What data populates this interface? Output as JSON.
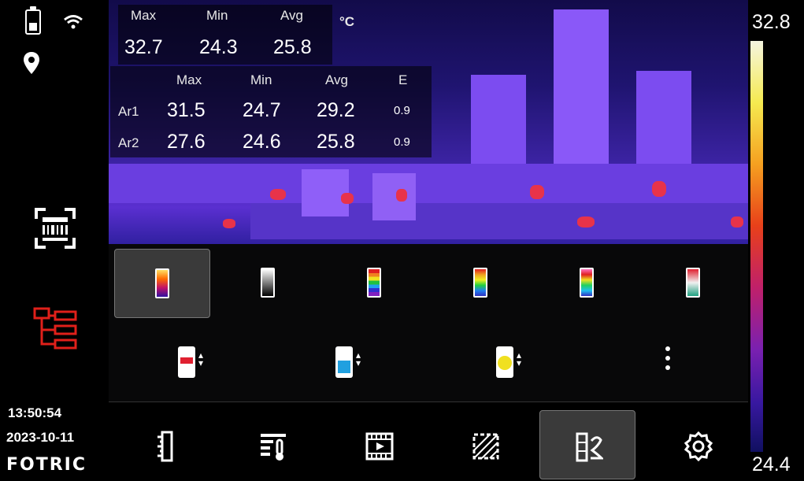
{
  "status": {
    "time": "13:50:54",
    "date": "2023-10-11",
    "brand": "FOTRIC"
  },
  "global_stats": {
    "headers": {
      "max": "Max",
      "min": "Min",
      "avg": "Avg",
      "unit": "°C"
    },
    "max": "32.7",
    "min": "24.3",
    "avg": "25.8"
  },
  "area_stats": {
    "headers": {
      "max": "Max",
      "min": "Min",
      "avg": "Avg",
      "e": "E"
    },
    "rows": [
      {
        "name": "Ar1",
        "max": "31.5",
        "min": "24.7",
        "avg": "29.2",
        "e": "0.9"
      },
      {
        "name": "Ar2",
        "max": "27.6",
        "min": "24.6",
        "avg": "25.8",
        "e": "0.9"
      }
    ]
  },
  "scale": {
    "max": "32.8",
    "min": "24.4"
  },
  "palettes": {
    "selected_index": 0,
    "items": [
      "iron-palette-icon",
      "grayscale-palette-icon",
      "rainbow-palette-icon",
      "rainbow-hc-palette-icon",
      "medical-palette-icon",
      "red-green-palette-icon"
    ]
  },
  "isotherm_modes": [
    "isotherm-above-icon",
    "isotherm-below-icon",
    "isotherm-interval-icon"
  ],
  "toolbar": {
    "selected_index": 4,
    "items": [
      "ruler-icon",
      "temperature-settings-icon",
      "media-player-icon",
      "hatched-area-icon",
      "palette-settings-icon",
      "gear-icon"
    ]
  },
  "colors": {
    "selection_bg": "#3a3a3a",
    "tree_icon": "#e0201a"
  }
}
